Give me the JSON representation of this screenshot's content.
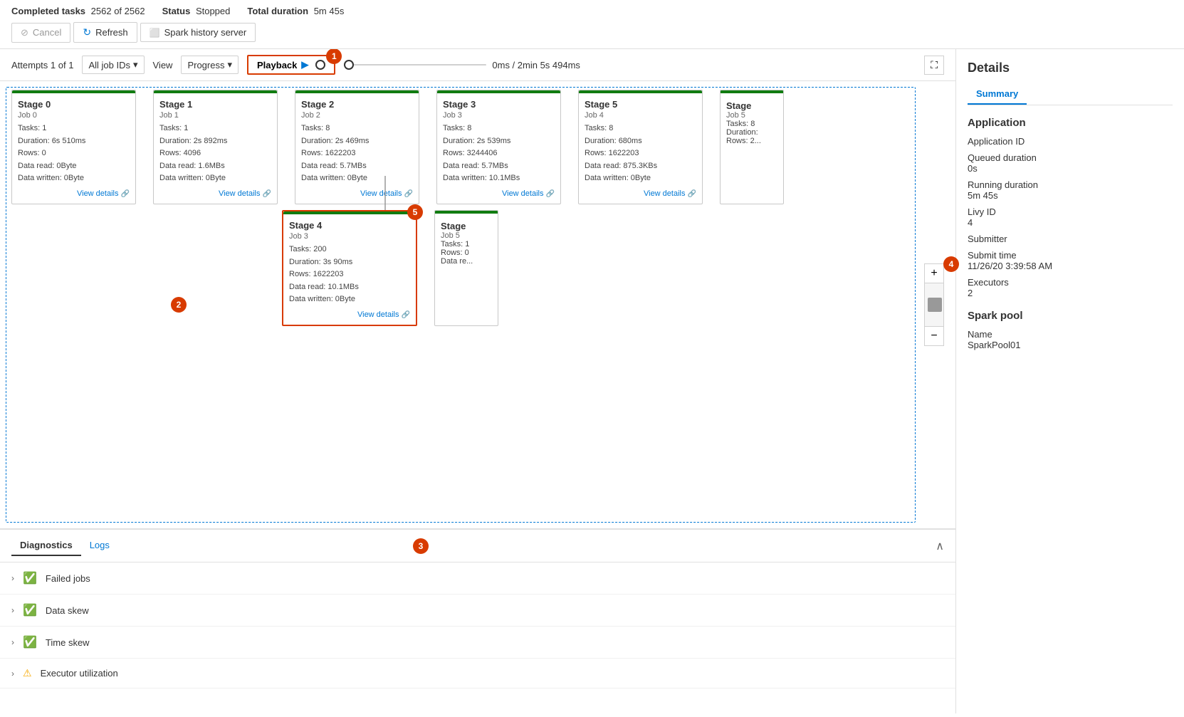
{
  "topbar": {
    "completed_tasks_label": "Completed tasks",
    "completed_tasks_value": "2562 of 2562",
    "status_label": "Status",
    "status_value": "Stopped",
    "total_duration_label": "Total duration",
    "total_duration_value": "5m 45s",
    "cancel_label": "Cancel",
    "refresh_label": "Refresh",
    "spark_history_label": "Spark history server"
  },
  "graph": {
    "attempts_label": "Attempts 1 of 1",
    "view_label": "View",
    "all_job_ids": "All job IDs",
    "progress": "Progress",
    "playback_label": "Playback",
    "duration_text": "0ms / 2min 5s 494ms",
    "annotation_playback": "1",
    "annotation_canvas": "2",
    "annotation_diagnostics": "3",
    "annotation_details": "4",
    "annotation_stage4": "5"
  },
  "stages": {
    "stage0": {
      "title": "Stage 0",
      "job": "Job 0",
      "tasks": "Tasks: 1",
      "duration": "Duration: 6s 510ms",
      "rows": "Rows: 0",
      "data_read": "Data read: 0Byte",
      "data_written": "Data written: 0Byte",
      "view_details": "View details"
    },
    "stage1": {
      "title": "Stage 1",
      "job": "Job 1",
      "tasks": "Tasks: 1",
      "duration": "Duration: 2s 892ms",
      "rows": "Rows: 4096",
      "data_read": "Data read: 1.6MBs",
      "data_written": "Data written: 0Byte",
      "view_details": "View details"
    },
    "stage2": {
      "title": "Stage 2",
      "job": "Job 2",
      "tasks": "Tasks: 8",
      "duration": "Duration: 2s 469ms",
      "rows": "Rows: 1622203",
      "data_read": "Data read: 5.7MBs",
      "data_written": "Data written: 0Byte",
      "view_details": "View details"
    },
    "stage3": {
      "title": "Stage 3",
      "job": "Job 3",
      "tasks": "Tasks: 8",
      "duration": "Duration: 2s 539ms",
      "rows": "Rows: 3244406",
      "data_read": "Data read: 5.7MBs",
      "data_written": "Data written: 10.1MBs",
      "view_details": "View details"
    },
    "stage4": {
      "title": "Stage 4",
      "job": "Job 3",
      "tasks": "Tasks: 200",
      "duration": "Duration: 3s 90ms",
      "rows": "Rows: 1622203",
      "data_read": "Data read: 10.1MBs",
      "data_written": "Data written: 0Byte",
      "view_details": "View details"
    },
    "stage5": {
      "title": "Stage 5",
      "job": "Job 4",
      "tasks": "Tasks: 8",
      "duration": "Duration: 680ms",
      "rows": "Rows: 1622203",
      "data_read": "Data read: 875.3KBs",
      "data_written": "Data written: 0Byte",
      "view_details": "View details"
    },
    "stage5b_title": "Stage",
    "stage5b_job": "Job 5",
    "stage5b_tasks": "Tasks: 8",
    "stage5b_rows": "Rows: 2...",
    "stage6_title": "Stage",
    "stage6_job": "Job 5"
  },
  "diagnostics": {
    "tab_diagnostics": "Diagnostics",
    "tab_logs": "Logs",
    "items": [
      {
        "label": "Failed jobs",
        "status": "ok"
      },
      {
        "label": "Data skew",
        "status": "ok"
      },
      {
        "label": "Time skew",
        "status": "ok"
      },
      {
        "label": "Executor utilization",
        "status": "warn"
      }
    ]
  },
  "details": {
    "title": "Details",
    "tab_summary": "Summary",
    "application_label": "Application",
    "application_id_label": "Application ID",
    "application_id_value": "",
    "queued_duration_label": "Queued duration",
    "queued_duration_value": "0s",
    "running_duration_label": "Running duration",
    "running_duration_value": "5m 45s",
    "livy_id_label": "Livy ID",
    "livy_id_value": "4",
    "submitter_label": "Submitter",
    "submitter_value": "",
    "submit_time_label": "Submit time",
    "submit_time_value": "11/26/20 3:39:58 AM",
    "executors_label": "Executors",
    "executors_value": "2",
    "spark_pool_label": "Spark pool",
    "name_label": "Name",
    "name_value": "SparkPool01"
  }
}
